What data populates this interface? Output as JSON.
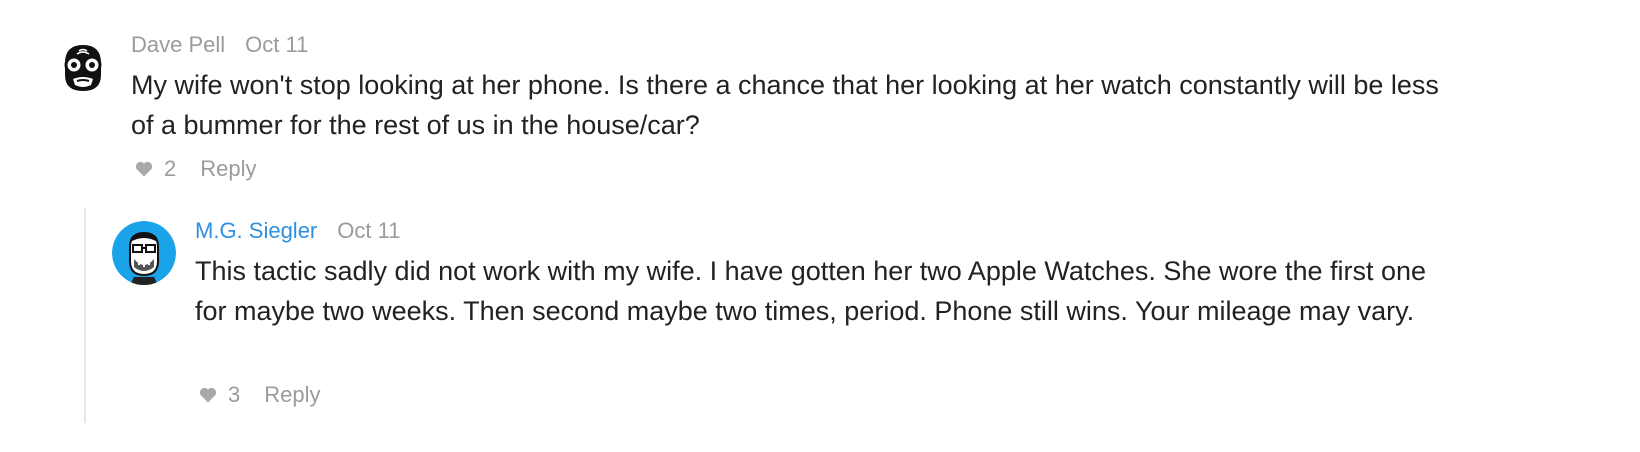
{
  "comments": [
    {
      "author": "Dave Pell",
      "date": "Oct 11",
      "body": "My wife won't stop looking at her phone. Is there a chance that her looking at her watch constantly will be less of a bummer for the rest of us in the house/car?",
      "likes": "2",
      "reply_label": "Reply"
    },
    {
      "author": "M.G. Siegler",
      "date": "Oct 11",
      "body": "This tactic sadly did not work with my wife. I have gotten her two Apple Watches. She wore the first one for maybe two weeks. Then second maybe two times, period. Phone still wins. Your mileage may vary.",
      "likes": "3",
      "reply_label": "Reply"
    }
  ],
  "colors": {
    "meta_gray": "#9b9b9b",
    "link_blue": "#2f8fe0",
    "thread_line": "#dfe9f3",
    "avatar_blue": "#1aa3e8"
  }
}
